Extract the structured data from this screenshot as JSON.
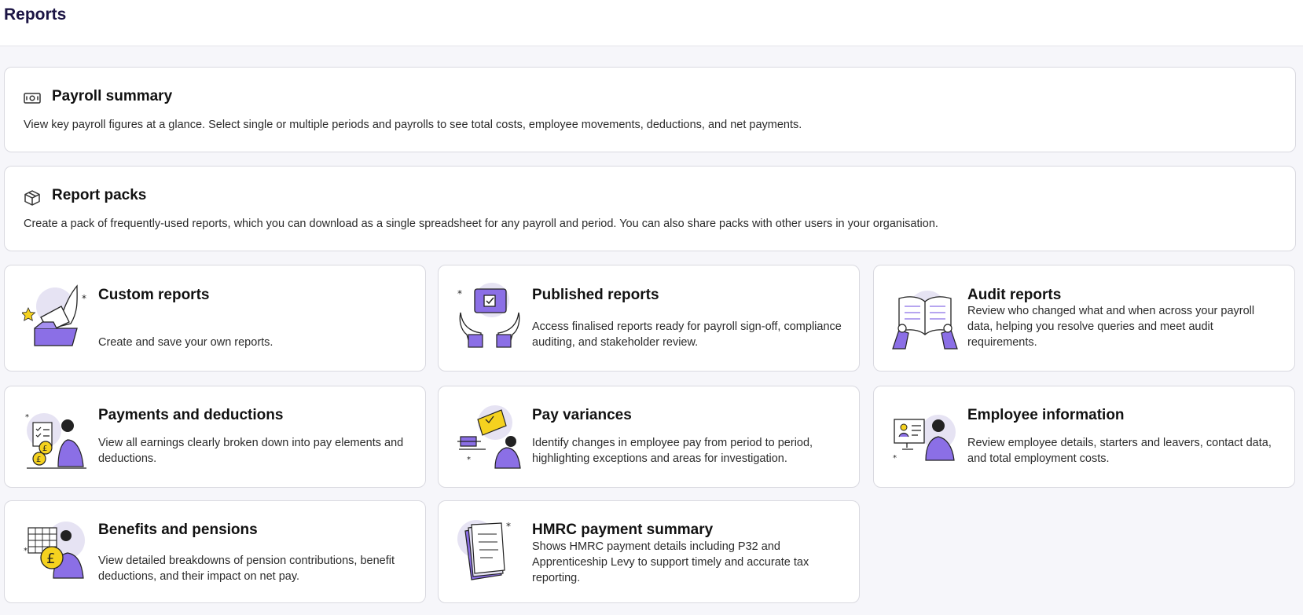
{
  "header": {
    "title": "Reports"
  },
  "wide_cards": [
    {
      "title": "Payroll summary",
      "icon": "banknote-icon",
      "description": "View key payroll figures at a glance. Select single or multiple periods and payrolls to see total costs, employee movements, deductions, and net payments."
    },
    {
      "title": "Report packs",
      "icon": "package-icon",
      "description": "Create a pack of frequently-used reports, which you can download as a single spreadsheet for any payroll and period. You can also share packs with other users in your organisation."
    }
  ],
  "tiles": [
    {
      "title": "Custom reports",
      "description": "Create and save your own reports."
    },
    {
      "title": "Published reports",
      "description": "Access finalised reports ready for payroll sign-off, compliance auditing, and stakeholder review."
    },
    {
      "title": "Audit reports",
      "description": "Review who changed what and when across your payroll data, helping you resolve queries and meet audit requirements."
    },
    {
      "title": "Payments and deductions",
      "description": "View all earnings clearly broken down into pay elements and deductions."
    },
    {
      "title": "Pay variances",
      "description": "Identify changes in employee pay from period to period, highlighting exceptions and areas for investigation."
    },
    {
      "title": "Employee information",
      "description": "Review employee details, starters and leavers, contact data, and total employment costs."
    },
    {
      "title": "Benefits and pensions",
      "description": "View detailed breakdowns of pension contributions, benefit deductions, and their impact on net pay."
    },
    {
      "title": "HMRC payment summary",
      "description": "Shows HMRC payment details including P32 and Apprenticeship Levy to support timely and accurate tax reporting."
    }
  ],
  "colors": {
    "accent": "#8b6fe6",
    "blob": "#e6e3f3",
    "title": "#1b1444",
    "yellow": "#f5d21f"
  }
}
